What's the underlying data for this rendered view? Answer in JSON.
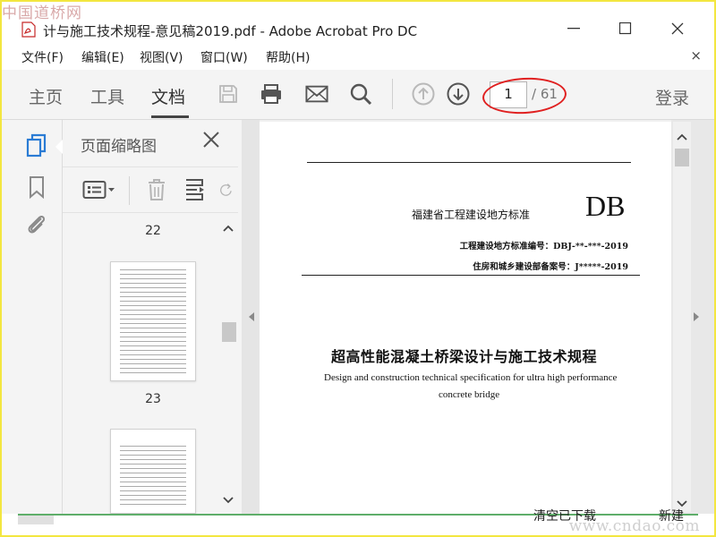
{
  "watermark": {
    "top": "中国道桥网",
    "bottom": "www.cndao.com"
  },
  "window": {
    "title": "计与施工技术规程-意见稿2019.pdf - Adobe Acrobat Pro DC",
    "minimize": "—",
    "maximize": "☐",
    "close": "✕"
  },
  "menu": {
    "items": [
      {
        "label": "文件(F)"
      },
      {
        "label": "编辑(E)"
      },
      {
        "label": "视图(V)"
      },
      {
        "label": "窗口(W)"
      },
      {
        "label": "帮助(H)"
      }
    ],
    "close": "×"
  },
  "toolbar": {
    "tabs": [
      {
        "label": "主页"
      },
      {
        "label": "工具"
      },
      {
        "label": "文档"
      }
    ],
    "active_tab": "文档",
    "page_current": "1",
    "page_total": "/ 61",
    "login": "登录"
  },
  "thumbnails_panel": {
    "title": "页面缩略图",
    "close": "✕",
    "pages": [
      {
        "label": "22"
      },
      {
        "label": "23"
      }
    ]
  },
  "document": {
    "std_org": "福建省工程建设地方标准",
    "db_mark": "DB",
    "std_number": "工程建设地方标准编号：DBJ-**-***-2019",
    "record_number": "住房和城乡建设部备案号：J*****-2019",
    "title_cn": "超高性能混凝土桥梁设计与施工技术规程",
    "title_en_line1": "Design and construction technical specification for ultra high performance",
    "title_en_line2": "concrete bridge"
  },
  "status": {
    "text1": "清空已下载",
    "text2": "新建"
  },
  "colors": {
    "highlight_ellipse": "#e02020",
    "frame": "#f3e640",
    "accent_blue": "#2a7bd4"
  }
}
